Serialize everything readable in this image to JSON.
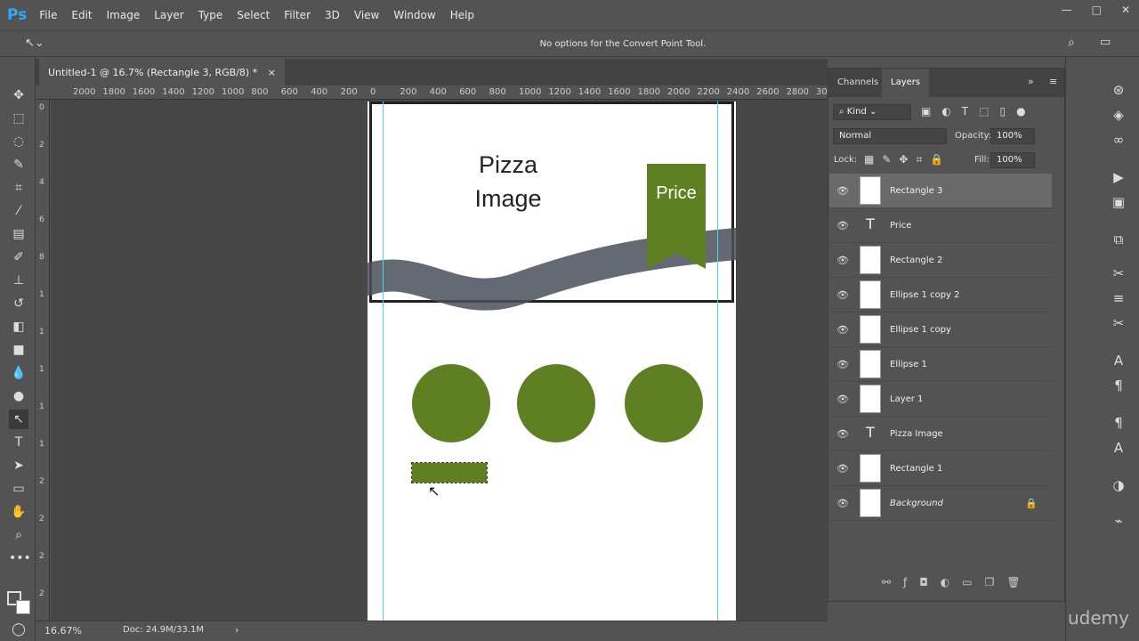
{
  "app": {
    "logo": "Ps",
    "menus": [
      "File",
      "Edit",
      "Image",
      "Layer",
      "Type",
      "Select",
      "Filter",
      "3D",
      "View",
      "Window",
      "Help"
    ],
    "window_controls": [
      "—",
      "□",
      "✕"
    ]
  },
  "options": {
    "message": "No options for the Convert Point Tool."
  },
  "document": {
    "tab_title": "Untitled-1 @ 16.7% (Rectangle 3, RGB/8) *",
    "close": "×",
    "ruler_h": [
      "2000",
      "1800",
      "1600",
      "1400",
      "1200",
      "1000",
      "800",
      "600",
      "400",
      "200",
      "0",
      "200",
      "400",
      "600",
      "800",
      "1000",
      "1200",
      "1400",
      "1600",
      "1800",
      "2000",
      "2200",
      "2400",
      "2600",
      "2800",
      "300"
    ],
    "ruler_v": [
      "0",
      "2",
      "4",
      "6",
      "8",
      "1",
      "1",
      "1",
      "1",
      "1",
      "2",
      "2",
      "2",
      "2"
    ],
    "canvas": {
      "title_line1": "Pizza",
      "title_line2": "Image",
      "price": "Price",
      "accent": "#5f7f23"
    }
  },
  "status": {
    "zoom": "16.67%",
    "doc": "Doc: 24.9M/33.1M"
  },
  "layers_panel": {
    "tabs": [
      "Channels",
      "Layers"
    ],
    "active_tab": "Layers",
    "filter": "Kind",
    "blend_mode": "Normal",
    "opacity_label": "Opacity:",
    "opacity": "100%",
    "lock_label": "Lock:",
    "fill_label": "Fill:",
    "fill": "100%",
    "layers": [
      {
        "name": "Rectangle 3",
        "type": "shape",
        "selected": true
      },
      {
        "name": "Price",
        "type": "text"
      },
      {
        "name": "Rectangle 2",
        "type": "shape"
      },
      {
        "name": "Ellipse 1 copy 2",
        "type": "shape"
      },
      {
        "name": "Ellipse 1 copy",
        "type": "shape"
      },
      {
        "name": "Ellipse 1",
        "type": "shape"
      },
      {
        "name": "Layer 1",
        "type": "pixel"
      },
      {
        "name": "Pizza Image",
        "type": "text"
      },
      {
        "name": "Rectangle 1",
        "type": "shape"
      },
      {
        "name": "Background",
        "type": "background",
        "locked": true
      }
    ],
    "footer_icons": [
      "link-icon",
      "fx-icon",
      "mask-icon",
      "adjustment-icon",
      "folder-icon",
      "new-layer-icon",
      "trash-icon"
    ]
  },
  "watermark": "udemy"
}
